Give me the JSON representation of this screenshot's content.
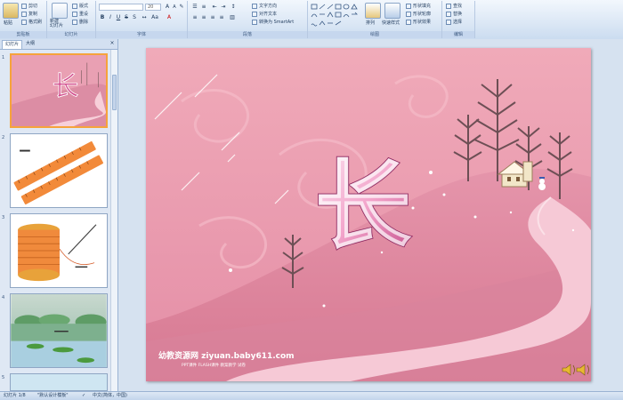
{
  "ribbon": {
    "clipboard": {
      "paste": "粘贴",
      "cut": "剪切",
      "copy": "复制",
      "format_painter": "格式刷",
      "label": "剪贴板"
    },
    "slides": {
      "new_slide": "新建\n幻灯片",
      "layout": "版式",
      "reset": "重设",
      "delete": "删除",
      "label": "幻灯片"
    },
    "font": {
      "font_size": "20",
      "label": "字体"
    },
    "paragraph": {
      "text_direction": "文字方向",
      "align_text": "对齐文本",
      "convert_smartart": "转换为 SmartArt",
      "label": "段落"
    },
    "drawing": {
      "arrange": "排列",
      "quick_styles": "快速样式",
      "shape_fill": "形状填充",
      "shape_outline": "形状轮廓",
      "shape_effects": "形状效果",
      "label": "绘图"
    },
    "editing": {
      "find": "查找",
      "replace": "替换",
      "select": "选择",
      "label": "编辑"
    }
  },
  "panel": {
    "tab_slides": "幻灯片",
    "tab_outline": "大纲"
  },
  "thumbnails": [
    {
      "num": "1"
    },
    {
      "num": "2"
    },
    {
      "num": "3"
    },
    {
      "num": "4"
    },
    {
      "num": "5"
    }
  ],
  "slide": {
    "character": "长",
    "website": "幼教资源网 ziyuan.baby611.com",
    "website_sub": "PPT课件 FLASH课件 教案教学 试卷"
  },
  "status": {
    "slide_info": "幻灯片 1/8",
    "theme": "\"默认设计模板\"",
    "language": "中文(简体，中国)"
  },
  "colors": {
    "accent": "#f6a33b",
    "slide_pink": "#e9a0b3",
    "road": "#f6c9d6"
  },
  "icons": [
    "paste-icon",
    "cut-icon",
    "copy-icon",
    "format-painter-icon",
    "new-slide-icon",
    "find-icon",
    "replace-icon",
    "select-icon",
    "speaker-icon",
    "spell-check-icon"
  ]
}
